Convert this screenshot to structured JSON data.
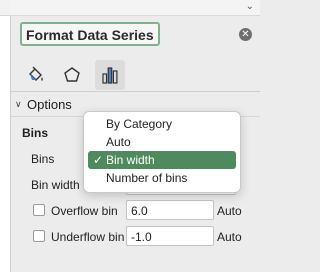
{
  "panel": {
    "title": "Format Data Series",
    "close_icon": "close-icon",
    "top_chevron_icon": "chevron-down-icon",
    "tabs": [
      {
        "icon": "paint-bucket-icon",
        "active": false
      },
      {
        "icon": "pentagon-icon",
        "active": false
      },
      {
        "icon": "bar-chart-icon",
        "active": true
      }
    ]
  },
  "options": {
    "section_label": "Options",
    "group_title": "Bins",
    "bins_label": "Bins",
    "bin_width_label": "Bin width",
    "overflow_label": "Overflow bin",
    "overflow_value": "6.0",
    "overflow_unit": "Auto",
    "underflow_label": "Underflow bin",
    "underflow_value": "-1.0",
    "underflow_unit": "Auto"
  },
  "dropdown": {
    "items": [
      {
        "label": "By Category",
        "selected": false
      },
      {
        "label": "Auto",
        "selected": false
      },
      {
        "label": "Bin width",
        "selected": true
      },
      {
        "label": "Number of bins",
        "selected": false
      }
    ],
    "check_mark": "✓"
  },
  "colors": {
    "accent": "#4f8a5c",
    "title_border": "#7fb28d"
  }
}
